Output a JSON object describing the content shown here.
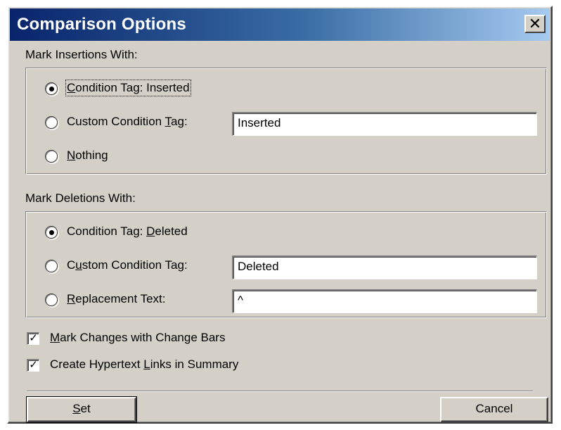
{
  "window": {
    "title": "Comparison Options",
    "close_glyph": "✕"
  },
  "insertions": {
    "heading": "Mark Insertions With:",
    "options": [
      {
        "pre": "",
        "key": "C",
        "post": "ondition Tag: Inserted",
        "selected": true
      },
      {
        "pre": "Custom Condition ",
        "key": "T",
        "post": "ag:",
        "selected": false
      },
      {
        "pre": "",
        "key": "N",
        "post": "othing",
        "selected": false
      }
    ],
    "custom_value": "Inserted"
  },
  "deletions": {
    "heading": "Mark Deletions With:",
    "options": [
      {
        "pre": "Condition Tag: ",
        "key": "D",
        "post": "eleted",
        "selected": true
      },
      {
        "pre": "C",
        "key": "u",
        "post": "stom Condition Tag:",
        "selected": false
      },
      {
        "pre": "",
        "key": "R",
        "post": "eplacement Text:",
        "selected": false
      }
    ],
    "custom_value": "Deleted",
    "replacement_value": "^"
  },
  "checkboxes": [
    {
      "pre": "",
      "key": "M",
      "post": "ark Changes with Change Bars",
      "checked": true
    },
    {
      "pre": "Create Hypertext ",
      "key": "L",
      "post": "inks in Summary",
      "checked": true
    }
  ],
  "buttons": {
    "set": {
      "pre": "",
      "key": "S",
      "post": "et"
    },
    "cancel": "Cancel"
  },
  "glyphs": {
    "check": "✓"
  }
}
